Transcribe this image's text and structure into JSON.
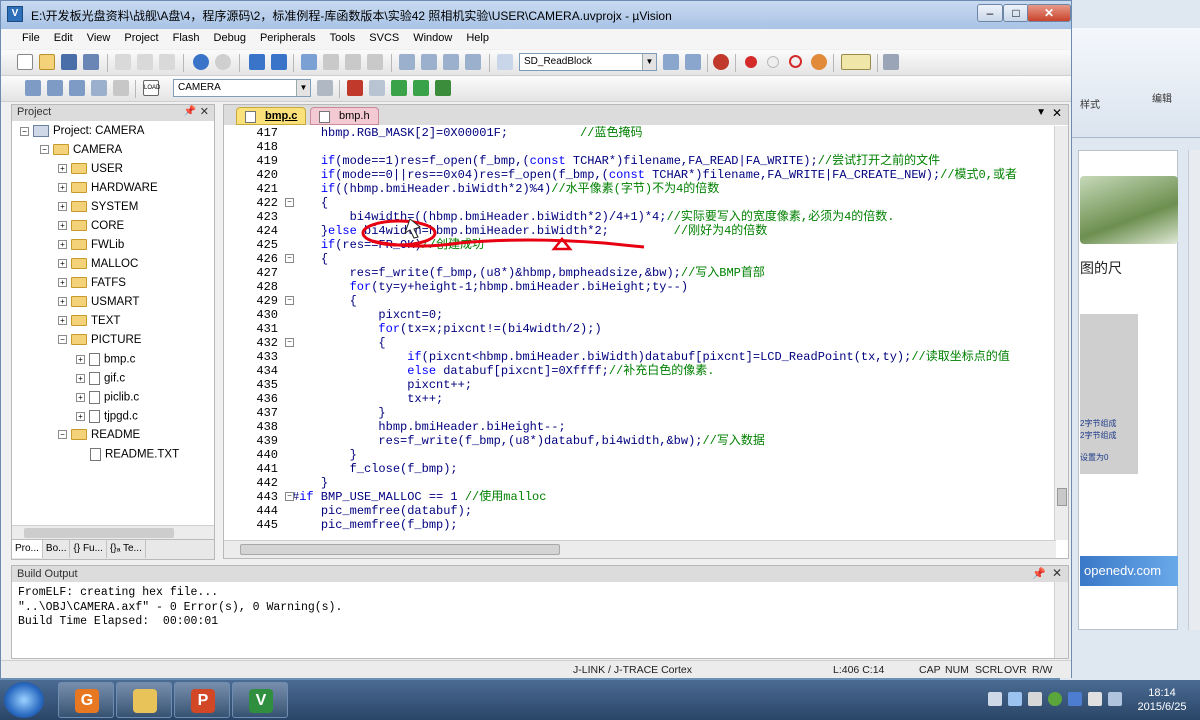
{
  "window": {
    "title": "E:\\开发板光盘资料\\战舰\\A盘\\4，程序源码\\2，标准例程-库函数版本\\实验42 照相机实验\\USER\\CAMERA.uvprojx - µVision",
    "app_icon_label": "V",
    "buttons": {
      "minimize": "–",
      "maximize": "□",
      "close": "✕"
    }
  },
  "menu": [
    "File",
    "Edit",
    "View",
    "Project",
    "Flash",
    "Debug",
    "Peripherals",
    "Tools",
    "SVCS",
    "Window",
    "Help"
  ],
  "toolbar": {
    "find_combo_value": "SD_ReadBlock",
    "target_combo_value": "CAMERA",
    "combo_arrow": "▼",
    "load_label": "LOAD"
  },
  "project_panel": {
    "title": "Project",
    "pin": "📌",
    "close": "✕",
    "root": "Project: CAMERA",
    "target": "CAMERA",
    "groups": [
      "USER",
      "HARDWARE",
      "SYSTEM",
      "CORE",
      "FWLib",
      "MALLOC",
      "FATFS",
      "USMART",
      "TEXT",
      "PICTURE"
    ],
    "picture_files": [
      "bmp.c",
      "gif.c",
      "piclib.c",
      "tjpgd.c"
    ],
    "readme_group": "README",
    "readme_file": "README.TXT",
    "tabs": [
      "Pro...",
      "Bo...",
      "{} Fu...",
      "{}ₐ Te..."
    ]
  },
  "editor": {
    "tabs": [
      "bmp.c",
      "bmp.h"
    ],
    "menu_glyph": "▼",
    "close_glyph": "✕",
    "fold_minus": "−",
    "lines": [
      {
        "n": "417",
        "indent": 1,
        "code": "hbmp.RGB_MASK[2]=0X00001F;",
        "comment": "          //蓝色掩码"
      },
      {
        "n": "418",
        "indent": 0,
        "code": "",
        "comment": ""
      },
      {
        "n": "419",
        "indent": 1,
        "code": "if(mode==1)res=f_open(f_bmp,(const TCHAR*)filename,FA_READ|FA_WRITE);",
        "comment": "//尝试打开之前的文件"
      },
      {
        "n": "420",
        "indent": 1,
        "code": "if(mode==0||res==0x04)res=f_open(f_bmp,(const TCHAR*)filename,FA_WRITE|FA_CREATE_NEW);",
        "comment": "//模式0,或者"
      },
      {
        "n": "421",
        "indent": 1,
        "code": "if((hbmp.bmiHeader.biWidth*2)%4)",
        "comment": "//水平像素(字节)不为4的倍数"
      },
      {
        "n": "422",
        "indent": 1,
        "code": "{",
        "comment": ""
      },
      {
        "n": "423",
        "indent": 2,
        "code": "bi4width=((hbmp.bmiHeader.biWidth*2)/4+1)*4;",
        "comment": "//实际要写入的宽度像素,必须为4的倍数."
      },
      {
        "n": "424",
        "indent": 1,
        "code": "}else bi4width=hbmp.bmiHeader.biWidth*2;",
        "comment": "         //刚好为4的倍数"
      },
      {
        "n": "425",
        "indent": 1,
        "code": "if(res==FR_OK)",
        "comment": "//创建成功"
      },
      {
        "n": "426",
        "indent": 1,
        "code": "{",
        "comment": ""
      },
      {
        "n": "427",
        "indent": 2,
        "code": "res=f_write(f_bmp,(u8*)&hbmp,bmpheadsize,&bw);",
        "comment": "//写入BMP首部"
      },
      {
        "n": "428",
        "indent": 2,
        "code": "for(ty=y+height-1;hbmp.bmiHeader.biHeight;ty--)",
        "comment": ""
      },
      {
        "n": "429",
        "indent": 2,
        "code": "{",
        "comment": ""
      },
      {
        "n": "430",
        "indent": 3,
        "code": "pixcnt=0;",
        "comment": ""
      },
      {
        "n": "431",
        "indent": 3,
        "code": "for(tx=x;pixcnt!=(bi4width/2);)",
        "comment": ""
      },
      {
        "n": "432",
        "indent": 3,
        "code": "{",
        "comment": ""
      },
      {
        "n": "433",
        "indent": 4,
        "code": "if(pixcnt<hbmp.bmiHeader.biWidth)databuf[pixcnt]=LCD_ReadPoint(tx,ty);",
        "comment": "//读取坐标点的值"
      },
      {
        "n": "434",
        "indent": 4,
        "code": "else databuf[pixcnt]=0Xffff;",
        "comment": "//补充白色的像素."
      },
      {
        "n": "435",
        "indent": 4,
        "code": "pixcnt++;",
        "comment": ""
      },
      {
        "n": "436",
        "indent": 4,
        "code": "tx++;",
        "comment": ""
      },
      {
        "n": "437",
        "indent": 3,
        "code": "}",
        "comment": ""
      },
      {
        "n": "438",
        "indent": 3,
        "code": "hbmp.bmiHeader.biHeight--;",
        "comment": ""
      },
      {
        "n": "439",
        "indent": 3,
        "code": "res=f_write(f_bmp,(u8*)databuf,bi4width,&bw);",
        "comment": "//写入数据"
      },
      {
        "n": "440",
        "indent": 2,
        "code": "}",
        "comment": ""
      },
      {
        "n": "441",
        "indent": 2,
        "code": "f_close(f_bmp);",
        "comment": ""
      },
      {
        "n": "442",
        "indent": 1,
        "code": "}",
        "comment": ""
      },
      {
        "n": "443",
        "indent": 0,
        "code": "#if BMP_USE_MALLOC == 1",
        "comment": " //使用malloc"
      },
      {
        "n": "444",
        "indent": 1,
        "code": "pic_memfree(databuf);",
        "comment": ""
      },
      {
        "n": "445",
        "indent": 1,
        "code": "pic_memfree(f_bmp);",
        "comment": ""
      }
    ]
  },
  "build_output": {
    "title": "Build Output",
    "lines": [
      "FromELF: creating hex file...",
      "\"..\\OBJ\\CAMERA.axf\" - 0 Error(s), 0 Warning(s).",
      "Build Time Elapsed:  00:00:01"
    ]
  },
  "status_bar": {
    "debugger": "J-LINK / J-TRACE Cortex",
    "position": "L:406 C:14",
    "indicators": [
      "CAP",
      "NUM",
      "SCRL",
      "OVR",
      "R/W"
    ]
  },
  "background_app": {
    "ribbon_label_1": "样式",
    "ribbon_label_2": "编辑",
    "heading": "图的尺",
    "notes": [
      "2字节组成",
      "2字节组成",
      "设置为0"
    ],
    "brand": "openedv.com"
  },
  "taskbar": {
    "apps": [
      {
        "name": "foxit-pdf",
        "label": "G",
        "color": "#e87722"
      },
      {
        "name": "explorer",
        "label": "",
        "color": "#e8c35a"
      },
      {
        "name": "powerpoint",
        "label": "P",
        "color": "#d24726"
      },
      {
        "name": "uvision",
        "label": "V",
        "color": "#2f8f3e"
      }
    ],
    "time": "18:14",
    "date": "2015/6/25"
  },
  "colors": {
    "keyword": "#0000ff",
    "comment": "#008000",
    "code": "#00007f",
    "annotation": "#e60012"
  }
}
